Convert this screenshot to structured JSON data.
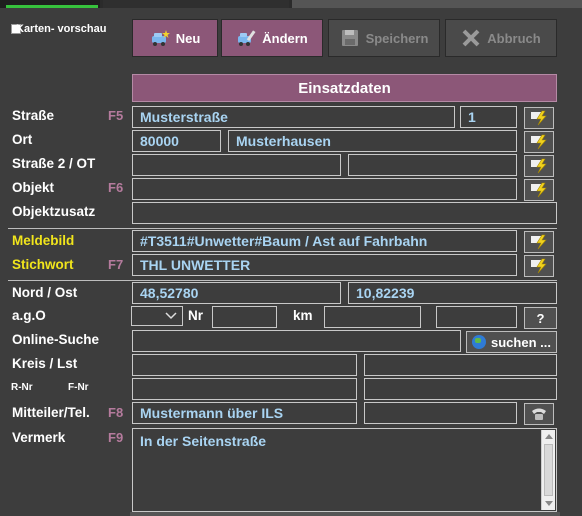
{
  "map_preview": {
    "label": "Karten- vorschau"
  },
  "toolbar": {
    "new_label": "Neu",
    "edit_label": "Ändern",
    "save_label": "Speichern",
    "cancel_label": "Abbruch"
  },
  "section_title": "Einsatzdaten",
  "labels": {
    "strasse": "Straße",
    "ort": "Ort",
    "strasse2": "Straße 2 / OT",
    "objekt": "Objekt",
    "objektzusatz": "Objektzusatz",
    "meldebild": "Meldebild",
    "stichwort": "Stichwort",
    "nord_ost": "Nord / Ost",
    "ago": "a.g.O",
    "nr": "Nr",
    "km": "km",
    "online_suche": "Online-Suche",
    "kreis_lst": "Kreis / Lst",
    "r_nr": "R-Nr",
    "f_nr": "F-Nr",
    "mitteiler": "Mitteiler/Tel.",
    "vermerk": "Vermerk"
  },
  "fkeys": {
    "strasse": "F5",
    "objekt": "F6",
    "stichwort": "F7",
    "mitteiler": "F8",
    "vermerk": "F9"
  },
  "values": {
    "strasse": "Musterstraße",
    "hausnummer": "1",
    "plz": "80000",
    "ort": "Musterhausen",
    "meldebild": "#T3511#Unwetter#Baum / Ast auf Fahrbahn",
    "stichwort": "THL UNWETTER",
    "nord": "48,52780",
    "ost": "10,82239",
    "mitteiler": "Mustermann über ILS",
    "vermerk": "In der Seitenstraße"
  },
  "buttons": {
    "question": "?",
    "suchen": "suchen ..."
  },
  "colors": {
    "accent": "#8c5778",
    "field_text": "#a9d4f2",
    "highlight_label": "#f1e51c",
    "fkey": "#b57b9d",
    "background": "#3d3d3d"
  }
}
